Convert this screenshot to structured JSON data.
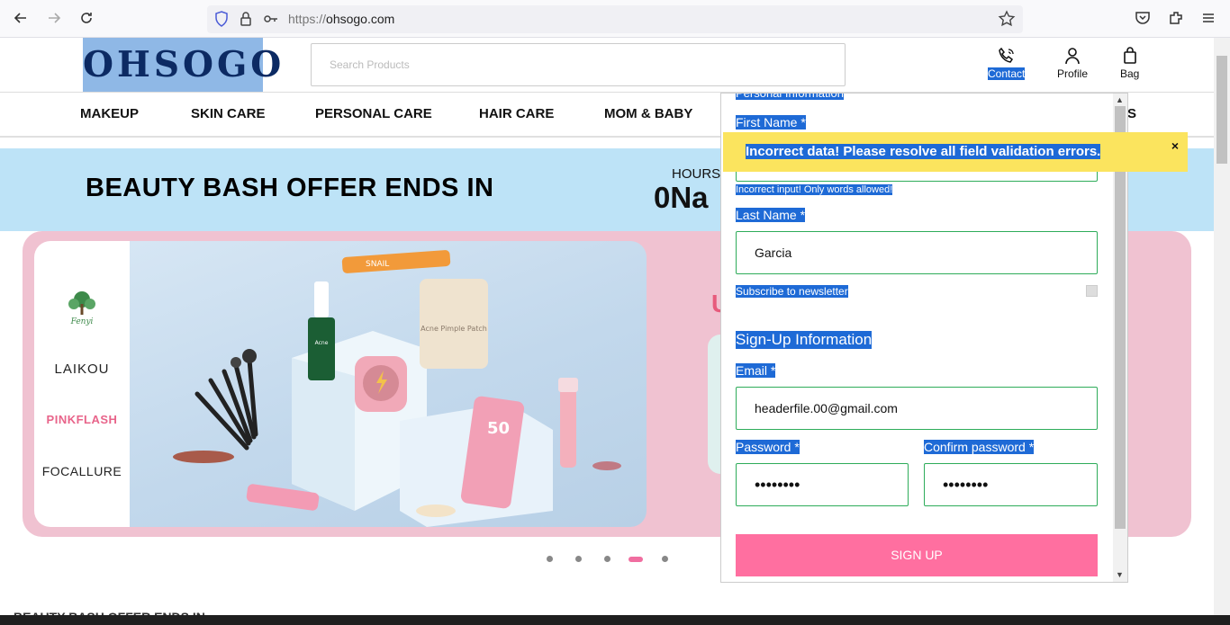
{
  "browser": {
    "url_protocol": "https://",
    "url_host": "ohsogo.com"
  },
  "header": {
    "logo": "OHSOGO",
    "search_placeholder": "Search Products",
    "contact_label": "Contact",
    "profile_label": "Profile",
    "bag_label": "Bag"
  },
  "categories": [
    "MAKEUP",
    "SKIN CARE",
    "PERSONAL CARE",
    "HAIR CARE",
    "MOM & BABY",
    "S"
  ],
  "offer": {
    "title": "BEAUTY BASH OFFER ENDS IN",
    "hours_label": "HOURS",
    "hours_value": "0Na"
  },
  "hero": {
    "brands": [
      "Fenyi",
      "LAIKOU",
      "PINKFLASH",
      "FOCALLURE"
    ],
    "partial_text": "U",
    "product_texts": [
      "SNAIL",
      "Acne Pimple Patch",
      "50"
    ]
  },
  "carousel": {
    "dots": 5,
    "active_index": 3
  },
  "form": {
    "section_personal": "Personal Information",
    "first_name_label": "First Name *",
    "first_name_error": "Incorrect input! Only words allowed!",
    "last_name_label": "Last Name *",
    "last_name_value": "Garcia",
    "newsletter_label": "Subscribe to newsletter",
    "section_signup": "Sign-Up Information",
    "email_label": "Email *",
    "email_value": "headerfile.00@gmail.com",
    "password_label": "Password *",
    "password_value": "••••••••",
    "confirm_label": "Confirm password *",
    "confirm_value": "••••••••",
    "signup_button": "SIGN UP"
  },
  "alert": {
    "message": "Incorrect data! Please resolve all field validation errors.",
    "close": "×"
  },
  "colors": {
    "selection": "#1e6ad6",
    "valid_border": "#2eac5a",
    "button_pink": "#ff6fa0",
    "alert_yellow": "#fbe45e",
    "offer_blue": "#bde3f7",
    "hero_pink": "#f0c2d1"
  }
}
